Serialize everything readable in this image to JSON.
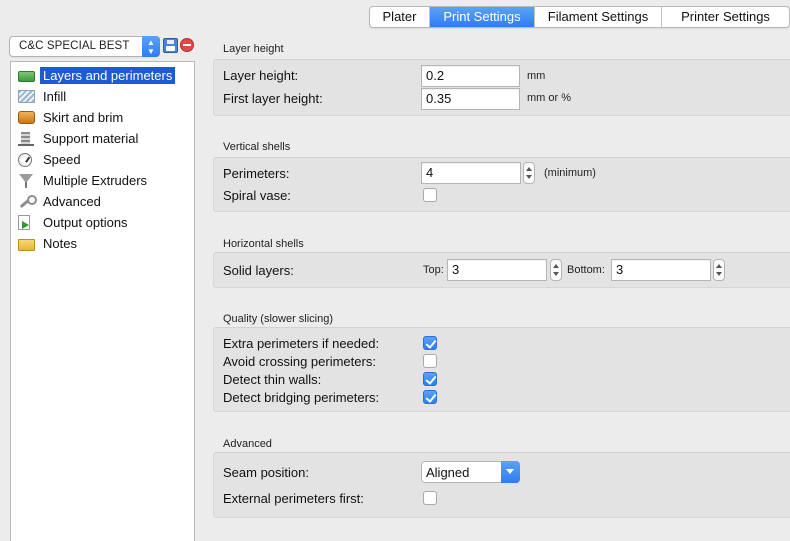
{
  "tabs": [
    {
      "label": "Plater",
      "active": false
    },
    {
      "label": "Print Settings",
      "active": true
    },
    {
      "label": "Filament Settings",
      "active": false
    },
    {
      "label": "Printer Settings",
      "active": false
    }
  ],
  "preset": {
    "selected": "C&C SPECIAL BEST",
    "arrows_icon": "up-down-chevron-icon",
    "save_icon": "save-icon",
    "delete_icon": "delete-icon"
  },
  "sidebar": {
    "items": [
      {
        "label": "Layers and perimeters",
        "icon": "layers-icon",
        "selected": true
      },
      {
        "label": "Infill",
        "icon": "infill-icon"
      },
      {
        "label": "Skirt and brim",
        "icon": "skirt-icon"
      },
      {
        "label": "Support material",
        "icon": "support-icon"
      },
      {
        "label": "Speed",
        "icon": "speed-icon"
      },
      {
        "label": "Multiple Extruders",
        "icon": "funnel-icon"
      },
      {
        "label": "Advanced",
        "icon": "wrench-icon"
      },
      {
        "label": "Output options",
        "icon": "output-icon"
      },
      {
        "label": "Notes",
        "icon": "notes-icon"
      }
    ]
  },
  "sections": {
    "layer_height": {
      "title": "Layer height",
      "layer_height": {
        "label": "Layer height:",
        "value": "0.2",
        "unit": "mm"
      },
      "first_layer_height": {
        "label": "First layer height:",
        "value": "0.35",
        "unit": "mm or %"
      }
    },
    "vertical_shells": {
      "title": "Vertical shells",
      "perimeters": {
        "label": "Perimeters:",
        "value": "4",
        "unit": "(minimum)"
      },
      "spiral_vase": {
        "label": "Spiral vase:",
        "checked": false
      }
    },
    "horizontal_shells": {
      "title": "Horizontal shells",
      "solid_layers": {
        "label": "Solid layers:",
        "top_label": "Top:",
        "top_value": "3",
        "bottom_label": "Bottom:",
        "bottom_value": "3"
      }
    },
    "quality": {
      "title": "Quality (slower slicing)",
      "extra_perimeters": {
        "label": "Extra perimeters if needed:",
        "checked": true
      },
      "avoid_crossing": {
        "label": "Avoid crossing perimeters:",
        "checked": false
      },
      "thin_walls": {
        "label": "Detect thin walls:",
        "checked": true
      },
      "bridging": {
        "label": "Detect bridging perimeters:",
        "checked": true
      }
    },
    "advanced": {
      "title": "Advanced",
      "seam_position": {
        "label": "Seam position:",
        "value": "Aligned"
      },
      "external_first": {
        "label": "External perimeters first:",
        "checked": false
      }
    }
  },
  "colors": {
    "accent": "#2f7cf0",
    "selection": "#1c5bd4",
    "section_bg": "#e3e3e3"
  }
}
